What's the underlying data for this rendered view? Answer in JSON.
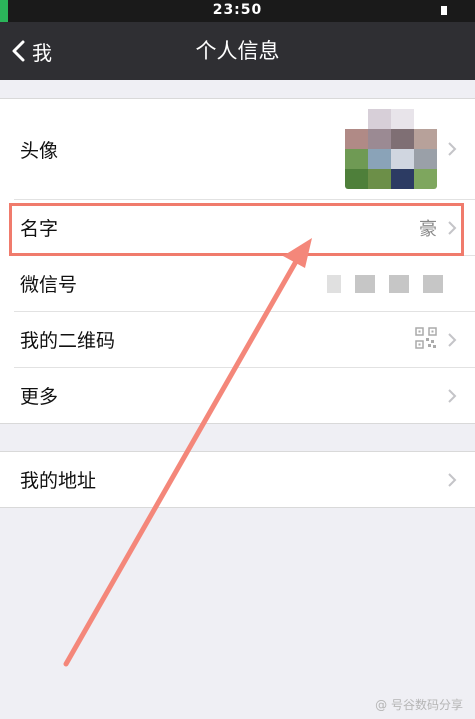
{
  "status_bar": {
    "time": "23:50"
  },
  "nav": {
    "back_label": "我",
    "title": "个人信息"
  },
  "profile": {
    "rows": [
      {
        "label": "头像"
      },
      {
        "label": "名字",
        "value": "豪"
      },
      {
        "label": "微信号"
      },
      {
        "label": "我的二维码"
      },
      {
        "label": "更多"
      }
    ]
  },
  "address": {
    "label": "我的地址"
  },
  "colors": {
    "nav_bg": "#2f2f33",
    "page_bg": "#efeff4",
    "highlight": "#f07b6c"
  },
  "watermark": "@ 号谷数码分享"
}
